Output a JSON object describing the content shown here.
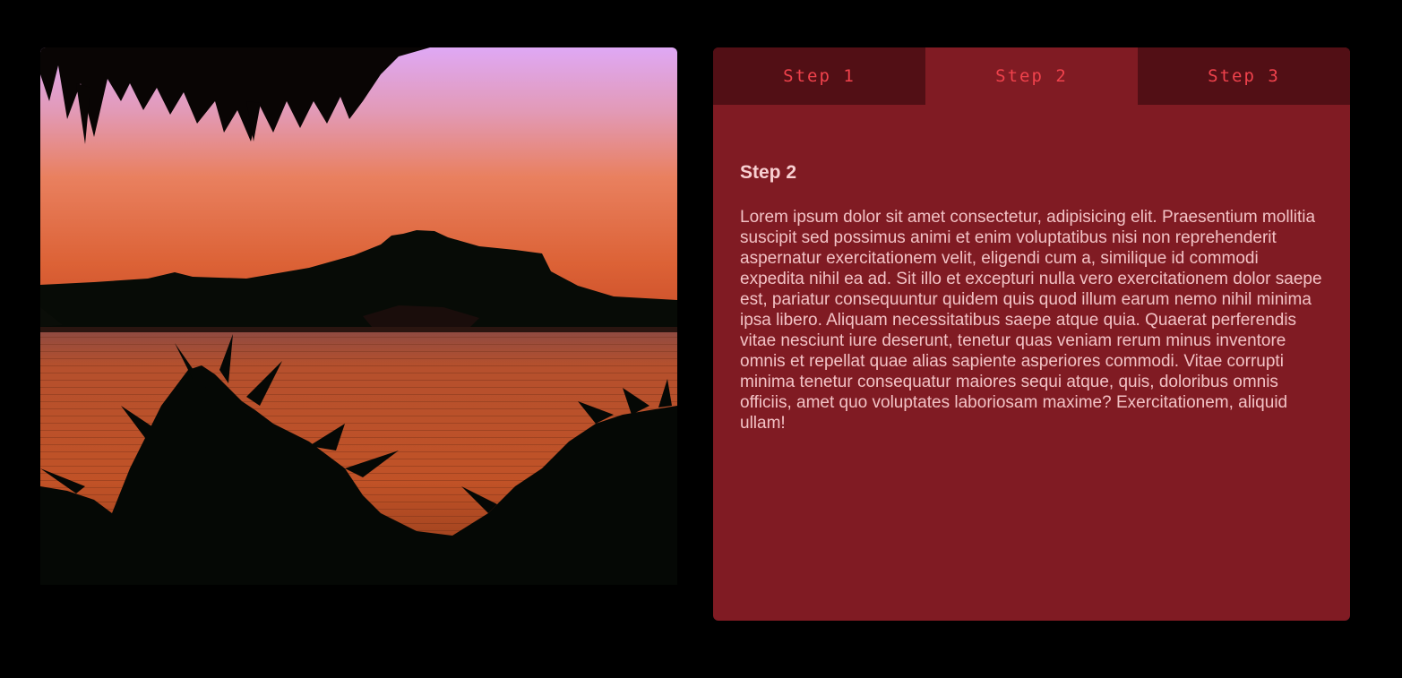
{
  "image": {
    "icon": "sunset-landscape-image",
    "colors": {
      "sky_top": "#dfa8f5",
      "sky_mid": "#e98168",
      "horizon": "#d2522a",
      "water": "#b84a25",
      "silhouette": "#050805"
    }
  },
  "panel": {
    "background": "#801b23",
    "tab_inactive_bg": "#520f15",
    "tab_text_color": "#f0424c"
  },
  "tabs": [
    {
      "label": "Step 1",
      "active": false
    },
    {
      "label": "Step 2",
      "active": true
    },
    {
      "label": "Step 3",
      "active": false
    }
  ],
  "content": {
    "title": "Step 2",
    "body": "Lorem ipsum dolor sit amet consectetur, adipisicing elit. Praesentium mollitia suscipit sed possimus animi et enim voluptatibus nisi non reprehenderit aspernatur exercitationem velit, eligendi cum a, similique id commodi expedita nihil ea ad. Sit illo et excepturi nulla vero exercitationem dolor saepe est, pariatur consequuntur quidem quis quod illum earum nemo nihil minima ipsa libero. Aliquam necessitatibus saepe atque quia. Quaerat perferendis vitae nesciunt iure deserunt, tenetur quas veniam rerum minus inventore omnis et repellat quae alias sapiente asperiores commodi. Vitae corrupti minima tenetur consequatur maiores sequi atque, quis, doloribus omnis officiis, amet quo voluptates laboriosam maxime? Exercitationem, aliquid ullam!"
  }
}
